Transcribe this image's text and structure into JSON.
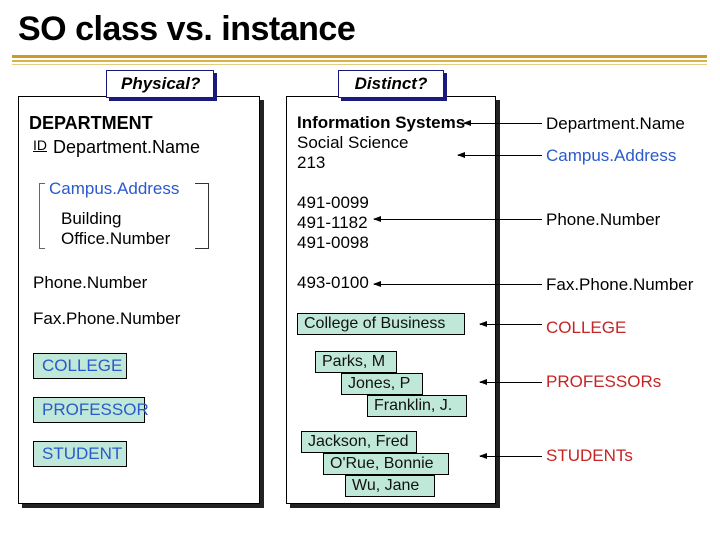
{
  "title": "SO class vs. instance",
  "tabs": {
    "left": "Physical?",
    "mid": "Distinct?"
  },
  "left_panel": {
    "dept_title": "DEPARTMENT",
    "id_label": "ID",
    "dept_name": "Department.Name",
    "campus_addr": "Campus.Address",
    "building": "Building",
    "office_num": "Office.Number",
    "phone_num": "Phone.Number",
    "fax_num": "Fax.Phone.Number",
    "college": "COLLEGE",
    "professor": "PROFESSOR",
    "student": "STUDENT"
  },
  "mid_panel": {
    "infosys": "Information Systems",
    "socsci": "Social Science",
    "room": "213",
    "phones": [
      "491-0099",
      "491-1182",
      "491-0098"
    ],
    "fax": "493-0100",
    "college": "College of Business",
    "profs": [
      "Parks, M",
      "Jones, P",
      "Franklin, J."
    ],
    "students": [
      "Jackson, Fred",
      "O'Rue, Bonnie",
      "Wu, Jane"
    ]
  },
  "right_labels": {
    "dept_name": "Department.Name",
    "campus": "Campus.Address",
    "phone": "Phone.Number",
    "fax": "Fax.Phone.Number",
    "college": "COLLEGE",
    "profs": "PROFESSORs",
    "students": "STUDENTs"
  }
}
